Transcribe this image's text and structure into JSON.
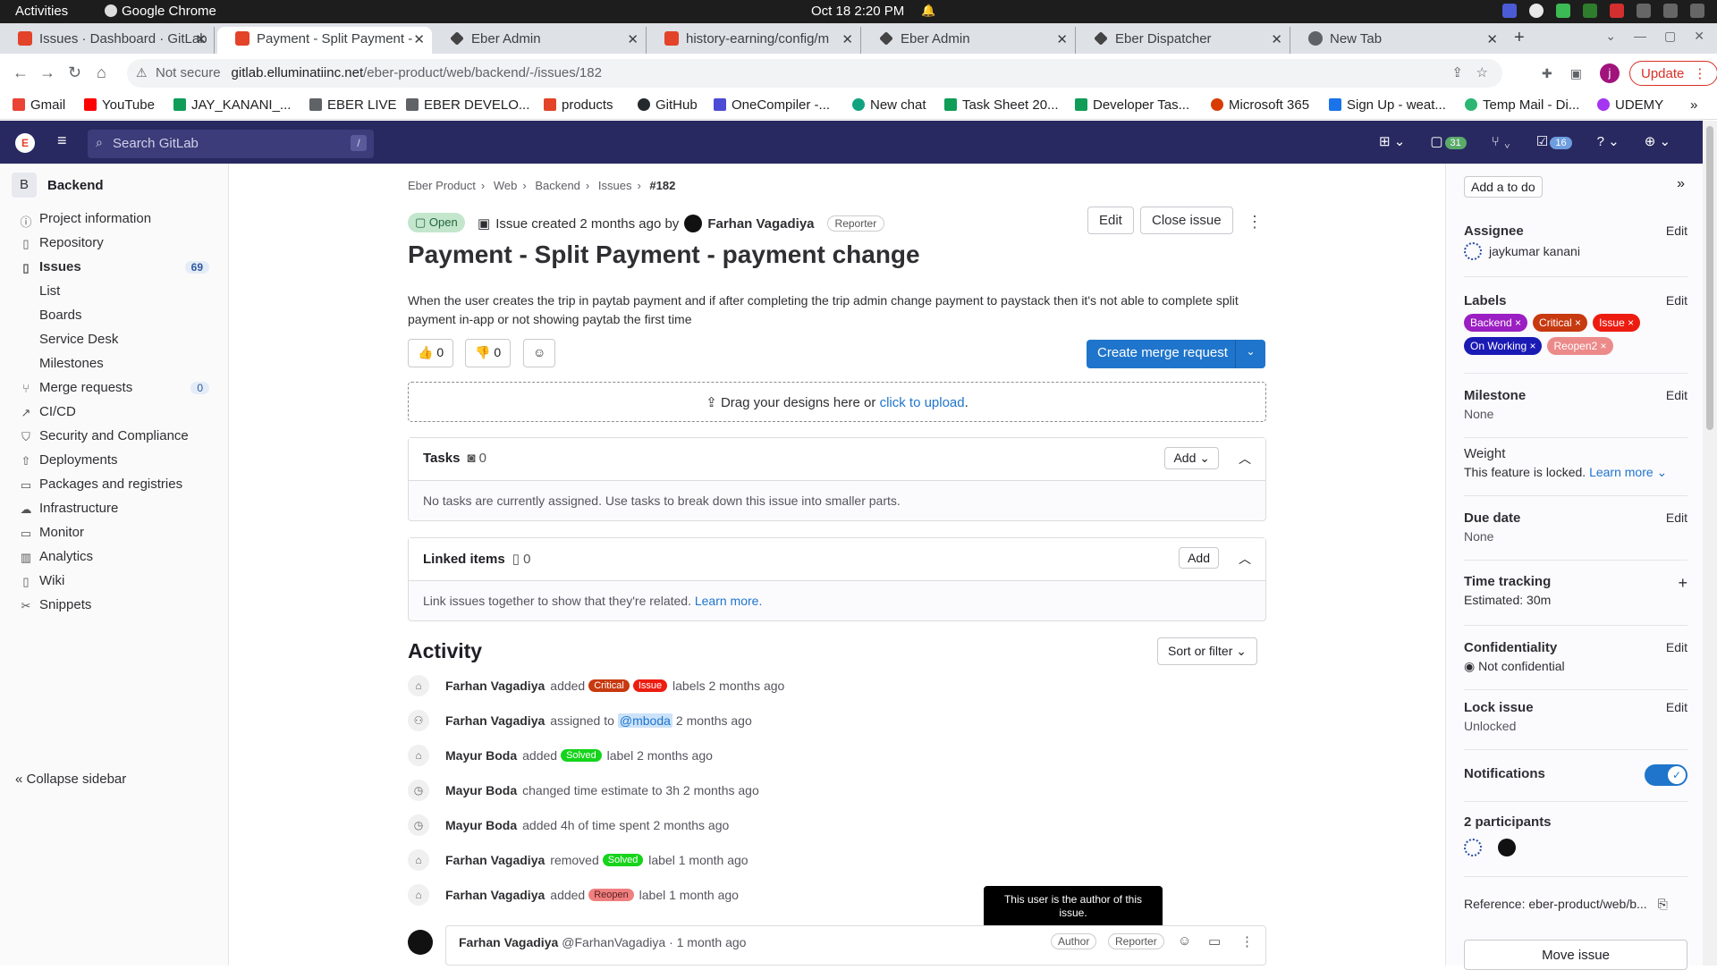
{
  "os": {
    "activities": "Activities",
    "app_name": "Google Chrome",
    "clock": "Oct 18  2:20 PM"
  },
  "tabs": [
    {
      "title": "Issues · Dashboard · GitLab",
      "color": "#e24329"
    },
    {
      "title": "Payment - Split Payment -",
      "color": "#e24329"
    },
    {
      "title": "Eber Admin",
      "color": "#333"
    },
    {
      "title": "history-earning/config/m",
      "color": "#e24329"
    },
    {
      "title": "Eber Admin",
      "color": "#333"
    },
    {
      "title": "Eber Dispatcher",
      "color": "#333"
    },
    {
      "title": "New Tab",
      "color": "#5f6368"
    }
  ],
  "address": {
    "security": "Not secure",
    "host": "gitlab.elluminatiinc.net",
    "path": "/eber-product/web/backend/-/issues/182"
  },
  "update_label": "Update",
  "bookmarks": [
    {
      "label": "Gmail",
      "color": "#ea4335"
    },
    {
      "label": "YouTube",
      "color": "#ff0000"
    },
    {
      "label": "JAY_KANANI_...",
      "color": "#0f9d58"
    },
    {
      "label": "EBER LIVE",
      "color": "#5f6368"
    },
    {
      "label": "EBER DEVELO...",
      "color": "#5f6368"
    },
    {
      "label": "products",
      "color": "#e24329"
    },
    {
      "label": "GitHub",
      "color": "#24292e"
    },
    {
      "label": "OneCompiler -...",
      "color": "#4b4bd6"
    },
    {
      "label": "New chat",
      "color": "#10a37f"
    },
    {
      "label": "Task Sheet 20...",
      "color": "#0f9d58"
    },
    {
      "label": "Developer Tas...",
      "color": "#0f9d58"
    },
    {
      "label": "Microsoft 365",
      "color": "#d83b01"
    },
    {
      "label": "Sign Up - weat...",
      "color": "#1a73e8"
    },
    {
      "label": "Temp Mail - Di...",
      "color": "#2bb673"
    },
    {
      "label": "UDEMY",
      "color": "#a435f0"
    }
  ],
  "gitlab": {
    "search_placeholder": "Search GitLab",
    "search_shortcut": "/",
    "mr_count": "31",
    "todo_count": "16"
  },
  "sidebar": {
    "project_initial": "B",
    "project_name": "Backend",
    "items": [
      {
        "label": "Project information",
        "icon": "info-icon"
      },
      {
        "label": "Repository",
        "icon": "doc-icon"
      },
      {
        "label": "Issues",
        "icon": "issues-icon",
        "badge": "69"
      },
      {
        "label": "Merge requests",
        "icon": "merge-icon",
        "badge": "0"
      },
      {
        "label": "CI/CD",
        "icon": "rocket-icon"
      },
      {
        "label": "Security and Compliance",
        "icon": "shield-icon"
      },
      {
        "label": "Deployments",
        "icon": "deploy-icon"
      },
      {
        "label": "Packages and registries",
        "icon": "package-icon"
      },
      {
        "label": "Infrastructure",
        "icon": "cloud-icon"
      },
      {
        "label": "Monitor",
        "icon": "monitor-icon"
      },
      {
        "label": "Analytics",
        "icon": "chart-icon"
      },
      {
        "label": "Wiki",
        "icon": "book-icon"
      },
      {
        "label": "Snippets",
        "icon": "scissors-icon"
      }
    ],
    "issues_sub": [
      "List",
      "Boards",
      "Service Desk",
      "Milestones"
    ],
    "collapse": "Collapse sidebar"
  },
  "breadcrumb": [
    "Eber Product",
    "Web",
    "Backend",
    "Issues",
    "#182"
  ],
  "issue": {
    "status": "Open",
    "created": "Issue created 2 months ago by",
    "author": "Farhan Vagadiya",
    "author_role": "Reporter",
    "edit": "Edit",
    "close": "Close issue",
    "title": "Payment - Split Payment - payment change",
    "description": "When the user creates the trip in paytab payment and if after completing the trip admin change payment to paystack then it's not able to complete split payment in-app or not showing paytab the first time",
    "thumbs_up": "0",
    "thumbs_down": "0",
    "create_mr": "Create merge request",
    "upload_text": "Drag your designs here or",
    "upload_link": "click to upload",
    "tasks_title": "Tasks",
    "tasks_count": "0",
    "tasks_add": "Add",
    "tasks_empty": "No tasks are currently assigned. Use tasks to break down this issue into smaller parts.",
    "linked_title": "Linked items",
    "linked_count": "0",
    "linked_add": "Add",
    "linked_empty": "Link issues together to show that they're related.",
    "linked_learn": "Learn more.",
    "activity_title": "Activity",
    "sort": "Sort or filter"
  },
  "activity": [
    {
      "user": "Farhan Vagadiya",
      "pre": "added",
      "labels": [
        {
          "t": "Critical",
          "c": "#c7390f"
        },
        {
          "t": "Issue",
          "c": "#ed1c10"
        }
      ],
      "post": "labels 2 months ago",
      "icon": "label-icon"
    },
    {
      "user": "Farhan Vagadiya",
      "pre": "assigned to",
      "mention": "@mboda",
      "post": "2 months ago",
      "icon": "user-icon"
    },
    {
      "user": "Mayur Boda",
      "pre": "added",
      "labels": [
        {
          "t": "Solved",
          "c": "#15d41b"
        }
      ],
      "post": "label 2 months ago",
      "icon": "label-icon"
    },
    {
      "user": "Mayur Boda",
      "pre": "changed time estimate to 3h 2 months ago",
      "icon": "clock-icon"
    },
    {
      "user": "Mayur Boda",
      "pre": "added 4h of time spent 2 months ago",
      "icon": "clock-icon"
    },
    {
      "user": "Farhan Vagadiya",
      "pre": "removed",
      "labels": [
        {
          "t": "Solved",
          "c": "#15d41b"
        }
      ],
      "post": "label 1 month ago",
      "icon": "label-icon"
    },
    {
      "user": "Farhan Vagadiya",
      "pre": "added",
      "labels": [
        {
          "t": "Reopen",
          "c": "#f08080"
        }
      ],
      "post": "label 1 month ago",
      "icon": "label-icon"
    }
  ],
  "tooltip": "This user is the author of this issue.",
  "note": {
    "user": "Farhan Vagadiya",
    "handle": "@FarhanVagadiya · 1 month ago",
    "author": "Author",
    "reporter": "Reporter"
  },
  "right": {
    "todo": "Add a to do",
    "assignee_title": "Assignee",
    "assignee": "jaykumar kanani",
    "labels_title": "Labels",
    "labels": [
      {
        "t": "Backend ×",
        "c": "#9b1fc2"
      },
      {
        "t": "Critical ×",
        "c": "#c7390f"
      },
      {
        "t": "Issue ×",
        "c": "#ed1c10"
      },
      {
        "t": "On Working ×",
        "c": "#1a1ab5"
      },
      {
        "t": "Reopen2 ×",
        "c": "#ec8a8a"
      }
    ],
    "milestone_title": "Milestone",
    "milestone": "None",
    "weight_title": "Weight",
    "weight": "This feature is locked.",
    "weight_learn": "Learn more",
    "due_title": "Due date",
    "due": "None",
    "time_title": "Time tracking",
    "time": "Estimated: 30m",
    "conf_title": "Confidentiality",
    "conf": "Not confidential",
    "lock_title": "Lock issue",
    "lock": "Unlocked",
    "notif_title": "Notifications",
    "participants_title": "2 participants",
    "reference": "Reference: eber-product/web/b...",
    "move": "Move issue",
    "edit": "Edit"
  }
}
